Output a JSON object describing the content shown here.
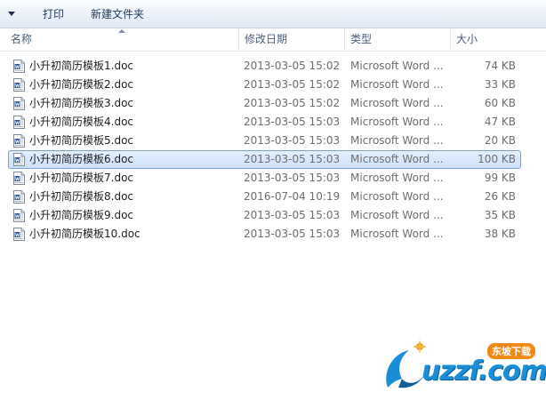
{
  "toolbar": {
    "print_label": "打印",
    "new_folder_label": "新建文件夹"
  },
  "columns": {
    "name": "名称",
    "date": "修改日期",
    "type": "类型",
    "size": "大小"
  },
  "files": [
    {
      "name": "小升初简历模板1.doc",
      "date": "2013-03-05 15:02",
      "type": "Microsoft Word ...",
      "size": "74 KB"
    },
    {
      "name": "小升初简历模板2.doc",
      "date": "2013-03-05 15:02",
      "type": "Microsoft Word ...",
      "size": "33 KB"
    },
    {
      "name": "小升初简历模板3.doc",
      "date": "2013-03-05 15:02",
      "type": "Microsoft Word ...",
      "size": "60 KB"
    },
    {
      "name": "小升初简历模板4.doc",
      "date": "2013-03-05 15:03",
      "type": "Microsoft Word ...",
      "size": "47 KB"
    },
    {
      "name": "小升初简历模板5.doc",
      "date": "2013-03-05 15:03",
      "type": "Microsoft Word ...",
      "size": "20 KB"
    },
    {
      "name": "小升初简历模板6.doc",
      "date": "2013-03-05 15:03",
      "type": "Microsoft Word ...",
      "size": "100 KB",
      "selected": true
    },
    {
      "name": "小升初简历模板7.doc",
      "date": "2013-03-05 15:03",
      "type": "Microsoft Word ...",
      "size": "99 KB"
    },
    {
      "name": "小升初简历模板8.doc",
      "date": "2016-07-04 10:19",
      "type": "Microsoft Word ...",
      "size": "26 KB"
    },
    {
      "name": "小升初简历模板9.doc",
      "date": "2013-03-05 15:03",
      "type": "Microsoft Word ...",
      "size": "35 KB"
    },
    {
      "name": "小升初简历模板10.doc",
      "date": "2013-03-05 15:03",
      "type": "Microsoft Word ...",
      "size": "38 KB"
    }
  ],
  "watermark": {
    "text": "uzzf.com",
    "badge": "东坡下载"
  },
  "colors": {
    "selection_border": "#7da2ce",
    "selection_fill": "#cfe2fb",
    "header_text": "#4c607a",
    "watermark_blue": "#1a8fd8",
    "watermark_orange": "#f08a16"
  }
}
